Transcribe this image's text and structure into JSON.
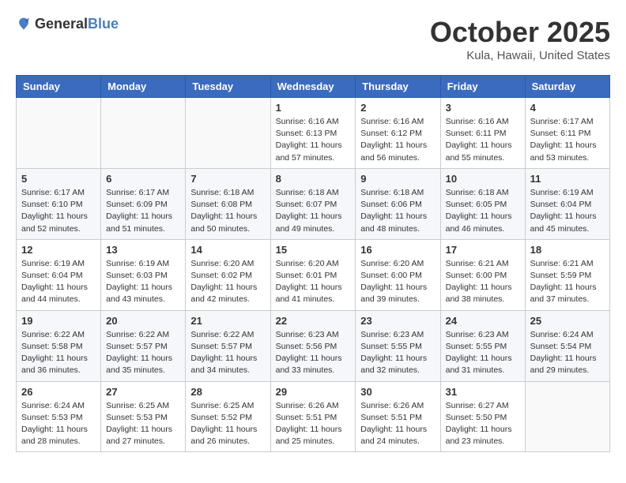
{
  "header": {
    "logo_general": "General",
    "logo_blue": "Blue",
    "month_title": "October 2025",
    "subtitle": "Kula, Hawaii, United States"
  },
  "days_of_week": [
    "Sunday",
    "Monday",
    "Tuesday",
    "Wednesday",
    "Thursday",
    "Friday",
    "Saturday"
  ],
  "weeks": [
    [
      {
        "day": "",
        "info": ""
      },
      {
        "day": "",
        "info": ""
      },
      {
        "day": "",
        "info": ""
      },
      {
        "day": "1",
        "info": "Sunrise: 6:16 AM\nSunset: 6:13 PM\nDaylight: 11 hours and 57 minutes."
      },
      {
        "day": "2",
        "info": "Sunrise: 6:16 AM\nSunset: 6:12 PM\nDaylight: 11 hours and 56 minutes."
      },
      {
        "day": "3",
        "info": "Sunrise: 6:16 AM\nSunset: 6:11 PM\nDaylight: 11 hours and 55 minutes."
      },
      {
        "day": "4",
        "info": "Sunrise: 6:17 AM\nSunset: 6:11 PM\nDaylight: 11 hours and 53 minutes."
      }
    ],
    [
      {
        "day": "5",
        "info": "Sunrise: 6:17 AM\nSunset: 6:10 PM\nDaylight: 11 hours and 52 minutes."
      },
      {
        "day": "6",
        "info": "Sunrise: 6:17 AM\nSunset: 6:09 PM\nDaylight: 11 hours and 51 minutes."
      },
      {
        "day": "7",
        "info": "Sunrise: 6:18 AM\nSunset: 6:08 PM\nDaylight: 11 hours and 50 minutes."
      },
      {
        "day": "8",
        "info": "Sunrise: 6:18 AM\nSunset: 6:07 PM\nDaylight: 11 hours and 49 minutes."
      },
      {
        "day": "9",
        "info": "Sunrise: 6:18 AM\nSunset: 6:06 PM\nDaylight: 11 hours and 48 minutes."
      },
      {
        "day": "10",
        "info": "Sunrise: 6:18 AM\nSunset: 6:05 PM\nDaylight: 11 hours and 46 minutes."
      },
      {
        "day": "11",
        "info": "Sunrise: 6:19 AM\nSunset: 6:04 PM\nDaylight: 11 hours and 45 minutes."
      }
    ],
    [
      {
        "day": "12",
        "info": "Sunrise: 6:19 AM\nSunset: 6:04 PM\nDaylight: 11 hours and 44 minutes."
      },
      {
        "day": "13",
        "info": "Sunrise: 6:19 AM\nSunset: 6:03 PM\nDaylight: 11 hours and 43 minutes."
      },
      {
        "day": "14",
        "info": "Sunrise: 6:20 AM\nSunset: 6:02 PM\nDaylight: 11 hours and 42 minutes."
      },
      {
        "day": "15",
        "info": "Sunrise: 6:20 AM\nSunset: 6:01 PM\nDaylight: 11 hours and 41 minutes."
      },
      {
        "day": "16",
        "info": "Sunrise: 6:20 AM\nSunset: 6:00 PM\nDaylight: 11 hours and 39 minutes."
      },
      {
        "day": "17",
        "info": "Sunrise: 6:21 AM\nSunset: 6:00 PM\nDaylight: 11 hours and 38 minutes."
      },
      {
        "day": "18",
        "info": "Sunrise: 6:21 AM\nSunset: 5:59 PM\nDaylight: 11 hours and 37 minutes."
      }
    ],
    [
      {
        "day": "19",
        "info": "Sunrise: 6:22 AM\nSunset: 5:58 PM\nDaylight: 11 hours and 36 minutes."
      },
      {
        "day": "20",
        "info": "Sunrise: 6:22 AM\nSunset: 5:57 PM\nDaylight: 11 hours and 35 minutes."
      },
      {
        "day": "21",
        "info": "Sunrise: 6:22 AM\nSunset: 5:57 PM\nDaylight: 11 hours and 34 minutes."
      },
      {
        "day": "22",
        "info": "Sunrise: 6:23 AM\nSunset: 5:56 PM\nDaylight: 11 hours and 33 minutes."
      },
      {
        "day": "23",
        "info": "Sunrise: 6:23 AM\nSunset: 5:55 PM\nDaylight: 11 hours and 32 minutes."
      },
      {
        "day": "24",
        "info": "Sunrise: 6:23 AM\nSunset: 5:55 PM\nDaylight: 11 hours and 31 minutes."
      },
      {
        "day": "25",
        "info": "Sunrise: 6:24 AM\nSunset: 5:54 PM\nDaylight: 11 hours and 29 minutes."
      }
    ],
    [
      {
        "day": "26",
        "info": "Sunrise: 6:24 AM\nSunset: 5:53 PM\nDaylight: 11 hours and 28 minutes."
      },
      {
        "day": "27",
        "info": "Sunrise: 6:25 AM\nSunset: 5:53 PM\nDaylight: 11 hours and 27 minutes."
      },
      {
        "day": "28",
        "info": "Sunrise: 6:25 AM\nSunset: 5:52 PM\nDaylight: 11 hours and 26 minutes."
      },
      {
        "day": "29",
        "info": "Sunrise: 6:26 AM\nSunset: 5:51 PM\nDaylight: 11 hours and 25 minutes."
      },
      {
        "day": "30",
        "info": "Sunrise: 6:26 AM\nSunset: 5:51 PM\nDaylight: 11 hours and 24 minutes."
      },
      {
        "day": "31",
        "info": "Sunrise: 6:27 AM\nSunset: 5:50 PM\nDaylight: 11 hours and 23 minutes."
      },
      {
        "day": "",
        "info": ""
      }
    ]
  ]
}
